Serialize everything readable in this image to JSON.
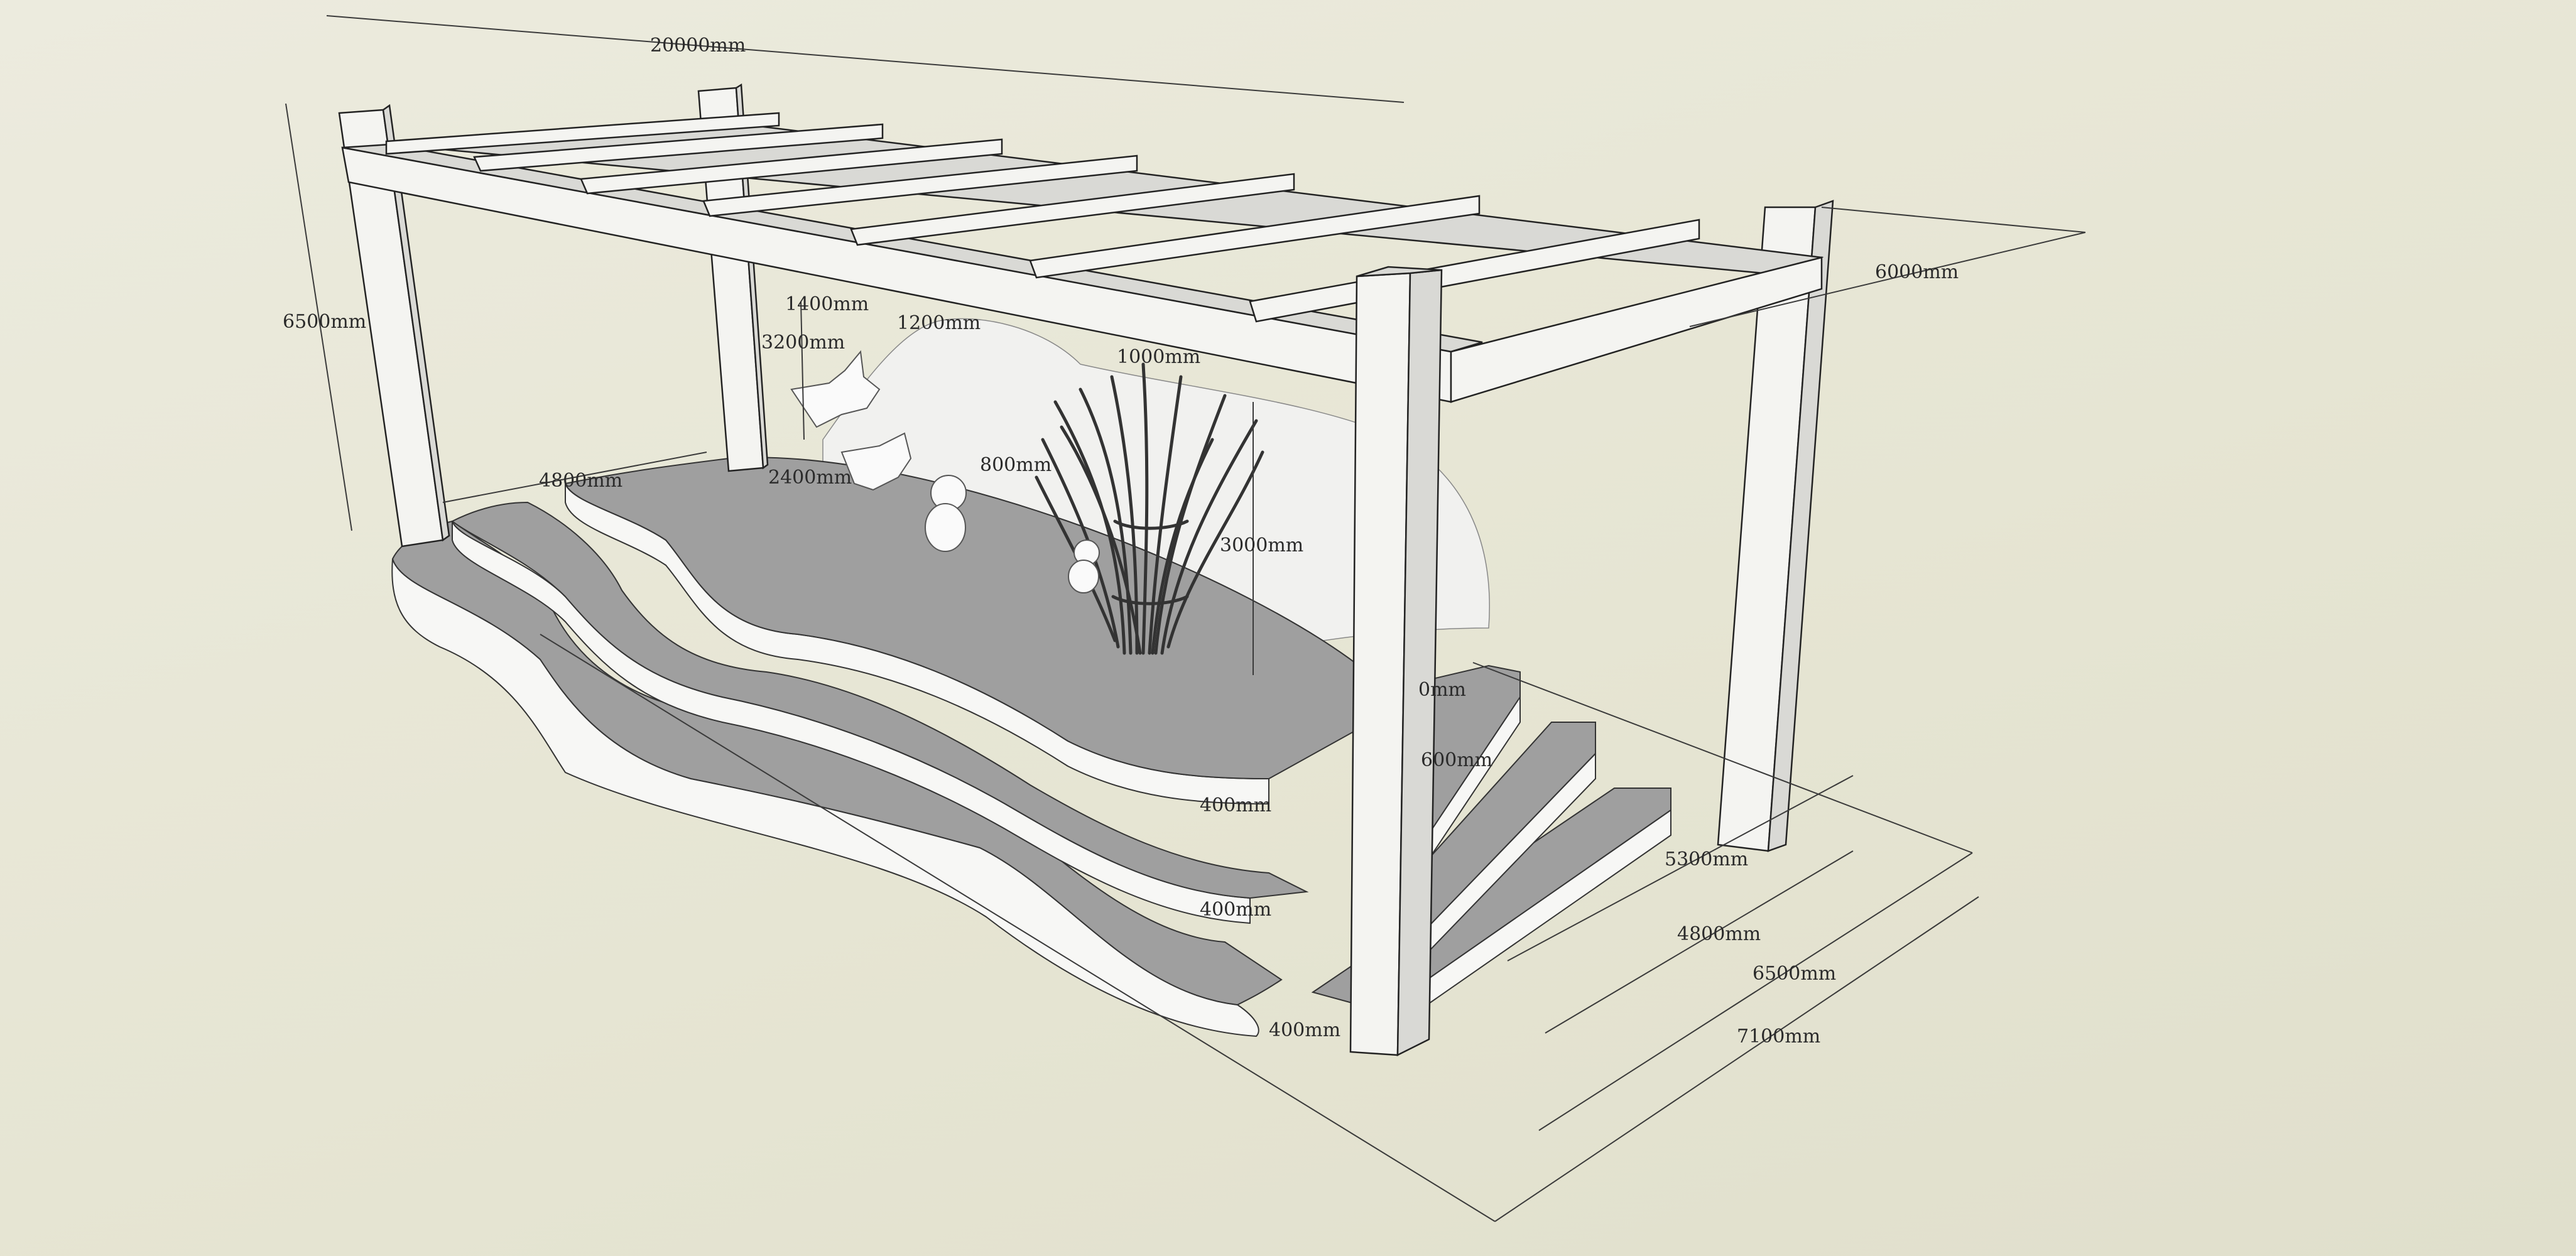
{
  "dimensions": {
    "total_length": "20000mm",
    "height": "6500mm",
    "roof_depth": "6000mm",
    "platform_left": "4800mm",
    "rail_a": "1400mm",
    "rail_b": "1200mm",
    "hang_height": "3200mm",
    "span_a": "2400mm",
    "span_b": "800mm",
    "top_gap": "1000mm",
    "tree_height": "3000mm",
    "step_a": "0mm",
    "step_b": "600mm",
    "riser_top": "400mm",
    "riser_mid": "400mm",
    "riser_low": "400mm",
    "depth_1": "5300mm",
    "depth_2": "4800mm",
    "depth_3": "6500mm",
    "depth_4": "7100mm"
  }
}
